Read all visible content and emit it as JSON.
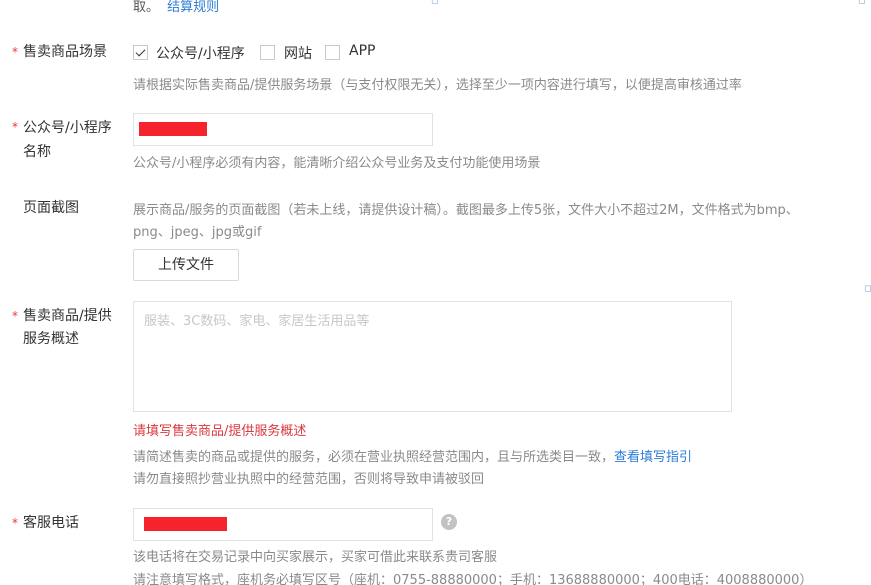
{
  "top": {
    "prefix": "取。",
    "link": "结算规则"
  },
  "scene": {
    "label": "售卖商品场景",
    "options": [
      {
        "label": "公众号/小程序",
        "checked": true
      },
      {
        "label": "网站",
        "checked": false
      },
      {
        "label": "APP",
        "checked": false
      }
    ],
    "hint": "请根据实际售卖商品/提供服务场景（与支付权限无关），选择至少一项内容进行填写，以便提高审核通过率"
  },
  "mp_name": {
    "label_line1": "公众号/小程序",
    "label_line2": "名称",
    "hint": "公众号/小程序必须有内容，能清晰介绍公众号业务及支付功能使用场景"
  },
  "screenshot": {
    "label": "页面截图",
    "hint_line1": "展示商品/服务的页面截图（若未上线，请提供设计稿）。截图最多上传5张，文件大小不超过2M，文件格式为bmp、",
    "hint_line2": "png、jpeg、jpg或gif",
    "upload_label": "上传文件"
  },
  "description": {
    "label_line1": "售卖商品/提供",
    "label_line2": "服务概述",
    "placeholder": "服装、3C数码、家电、家居生活用品等",
    "error": "请填写售卖商品/提供服务概述",
    "hint1": "请简述售卖的商品或提供的服务，必须在营业执照经营范围内，且与所选类目一致，",
    "hint1_link": "查看填写指引",
    "hint2": "请勿直接照抄营业执照中的经营范围，否则将导致申请被驳回"
  },
  "phone": {
    "label": "客服电话",
    "help": "?",
    "hint1": "该电话将在交易记录中向买家展示，买家可借此来联系贵司客服",
    "hint2": "请注意填写格式，座机务必填写区号（座机：0755-88880000；手机：13688880000；400电话：4008880000）"
  },
  "required_mark": "*",
  "colors": {
    "required": "#e0393e",
    "link": "#2d7bd4",
    "error": "#d9393e",
    "redaction": "#f5242c"
  }
}
